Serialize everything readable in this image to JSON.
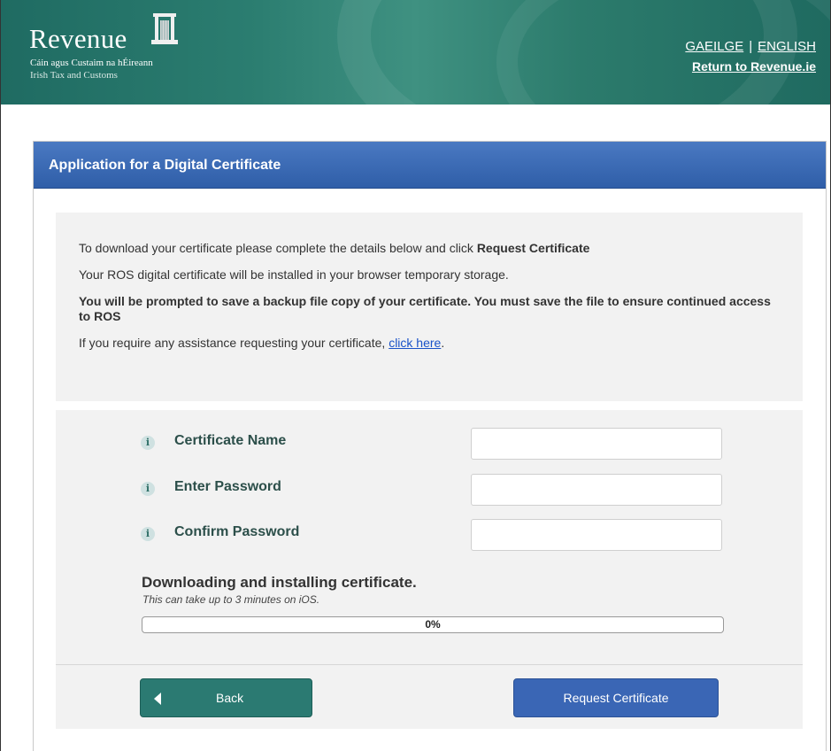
{
  "header": {
    "logo_text": "Revenue",
    "logo_subtitle_irish": "Cáin agus Custaim na hÉireann",
    "logo_subtitle_english": "Irish Tax and Customs",
    "lang_irish": "GAEILGE",
    "lang_separator": "|",
    "lang_english": "ENGLISH",
    "return_link": "Return to Revenue.ie",
    "colors": {
      "banner": "#2b7d70"
    }
  },
  "panel": {
    "title": "Application for a Digital Certificate",
    "colors": {
      "header": "#3a66b5"
    }
  },
  "info": {
    "line1_prefix": "To download your certificate please complete the details below and click ",
    "line1_bold": "Request Certificate",
    "line2": "Your ROS digital certificate will be installed in your browser temporary storage.",
    "line3": "You will be prompted to save a backup file copy of your certificate. You must save the file to ensure continued access to ROS",
    "line4_prefix": "If you require any assistance requesting your certificate, ",
    "line4_link": "click here",
    "line4_suffix": "."
  },
  "form": {
    "info_icon_glyph": "i",
    "fields": [
      {
        "label": "Certificate Name",
        "value": ""
      },
      {
        "label": "Enter Password",
        "value": ""
      },
      {
        "label": "Confirm Password",
        "value": ""
      }
    ],
    "download_title": "Downloading and installing certificate.",
    "download_note": "This can take up to 3 minutes on iOS.",
    "progress_label": "0%",
    "progress_fraction": 0
  },
  "buttons": {
    "back": "Back",
    "request": "Request Certificate",
    "colors": {
      "back": "#2b7a72",
      "request": "#3a66b5"
    }
  }
}
